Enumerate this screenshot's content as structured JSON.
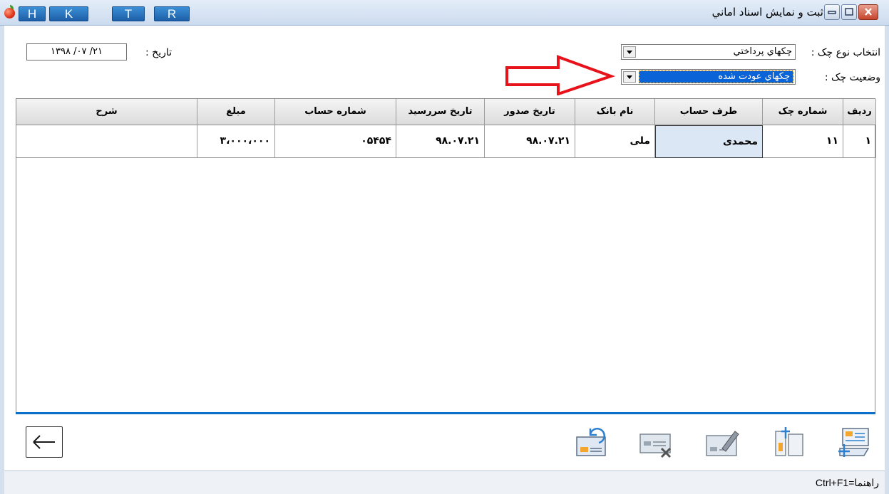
{
  "window": {
    "title": "ثبت و نمایش اسناد اماني",
    "quick_buttons": [
      "H",
      "K",
      "T",
      "R"
    ]
  },
  "filters": {
    "check_type_label": "انتخاب نوع چک :",
    "check_type_value": "چکهاي پرداختي",
    "check_status_label": "وضعيت چک   :",
    "check_status_value": "چکهاي عودت شده",
    "date_label": "تاريخ :",
    "date_value": "۱۳۹۸ /۰۷ /۲۱"
  },
  "table": {
    "columns": [
      "رديف",
      "شماره چک",
      "طرف حساب",
      "نام بانک",
      "تاريخ صدور",
      "تاريخ سررسيد",
      "شماره حساب",
      "مبلغ",
      "شرح"
    ],
    "rows": [
      [
        "۱",
        "۱۱",
        "محمدی",
        "ملی",
        "۹۸.۰۷.۲۱",
        "۹۸.۰۷.۲۱",
        "۰۵۴۵۴",
        "۳،۰۰۰،۰۰۰",
        ""
      ]
    ]
  },
  "toolbar": {
    "icons": [
      "add-check-icon",
      "transfer-check-icon",
      "edit-check-icon",
      "delete-check-icon",
      "return-check-icon"
    ],
    "back_icon": "back-arrow-icon"
  },
  "status": {
    "help_text": "Ctrl+F1=راهنما"
  },
  "colors": {
    "accent": "#0a64d8",
    "title_bar": "#cbdbee",
    "highlight_cell": "#dce7f6",
    "annotation_arrow": "#e8121b"
  }
}
